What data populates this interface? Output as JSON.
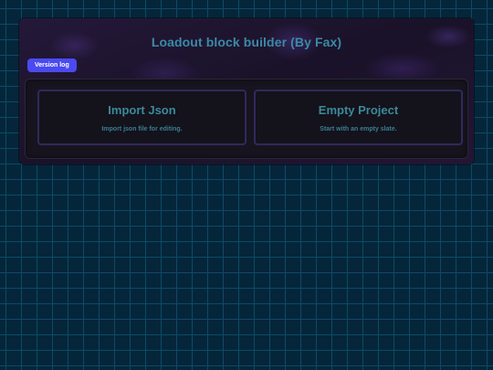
{
  "header": {
    "title": "Loadout block builder (By Fax)"
  },
  "toolbar": {
    "version_label": "Version log"
  },
  "options": [
    {
      "title": "Import Json",
      "description": "Import json file for editing."
    },
    {
      "title": "Empty Project",
      "description": "Start with an empty slate."
    }
  ],
  "colors": {
    "accent": "#4a4af0",
    "title": "#3a8aa8",
    "background": "#05263a",
    "grid": "#0c4a66",
    "card_border": "#2f2a5c"
  }
}
